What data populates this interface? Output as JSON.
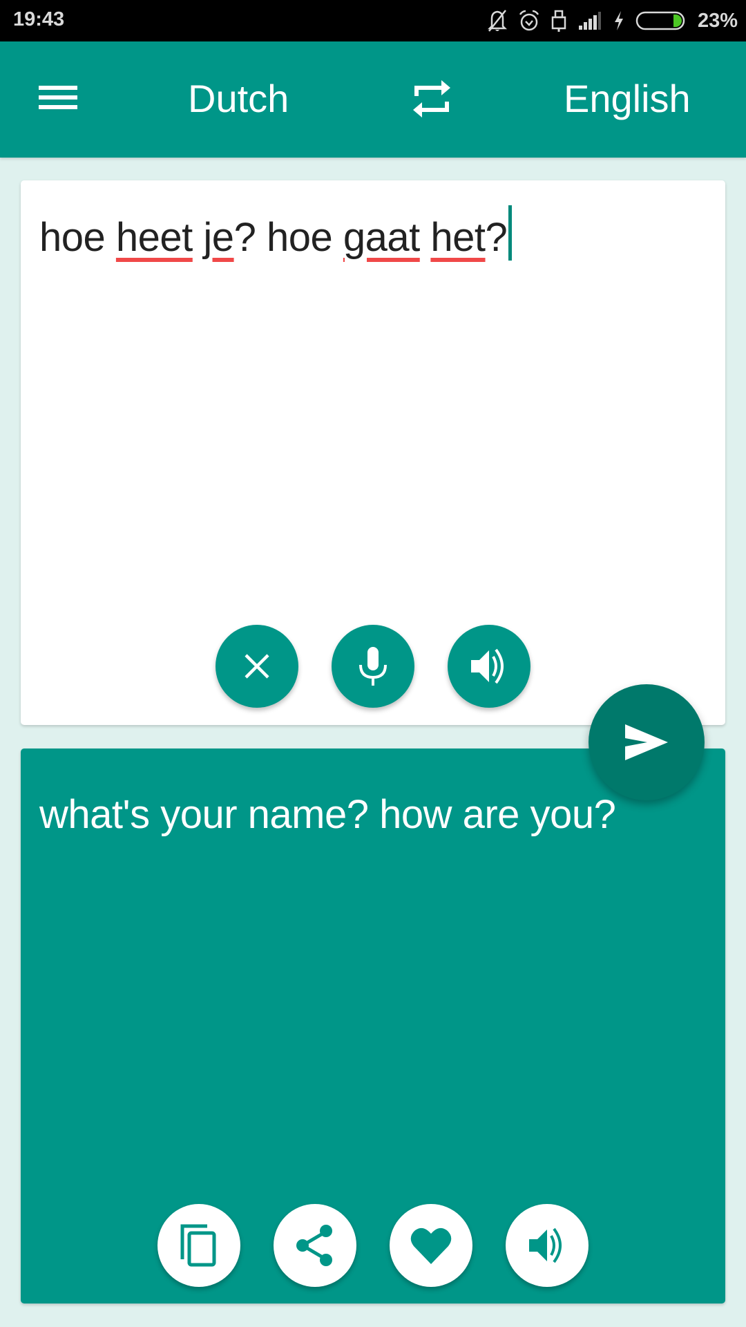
{
  "status_bar": {
    "time": "19:43",
    "battery_percent": "23%",
    "battery_level": 0.23,
    "icons": [
      "notifications-off-icon",
      "alarm-icon",
      "lock-icon",
      "signal-icon",
      "charging-icon",
      "battery-icon"
    ]
  },
  "app_bar": {
    "menu_icon": "hamburger-menu-icon",
    "source_language": "Dutch",
    "swap_icon": "swap-languages-icon",
    "target_language": "English"
  },
  "input_card": {
    "words": [
      {
        "text": "hoe",
        "misspelled": false
      },
      {
        "text": "heet",
        "misspelled": true
      },
      {
        "text": "je",
        "misspelled": true
      },
      {
        "text": "?",
        "misspelled": false
      },
      {
        "text": "hoe",
        "misspelled": false
      },
      {
        "text": "gaat",
        "misspelled": true
      },
      {
        "text": "het",
        "misspelled": true
      },
      {
        "text": "?",
        "misspelled": false
      }
    ],
    "value": "hoe heet je? hoe gaat het?",
    "buttons": [
      {
        "name": "clear",
        "icon": "close-icon"
      },
      {
        "name": "voice-input",
        "icon": "microphone-icon"
      },
      {
        "name": "speak-source",
        "icon": "speaker-icon"
      }
    ]
  },
  "translate_button": {
    "icon": "send-icon"
  },
  "output_card": {
    "value": "what's your name? how are you?",
    "buttons": [
      {
        "name": "copy",
        "icon": "copy-icon"
      },
      {
        "name": "share",
        "icon": "share-icon"
      },
      {
        "name": "favorite",
        "icon": "heart-icon"
      },
      {
        "name": "speak-translation",
        "icon": "speaker-icon"
      }
    ]
  },
  "colors": {
    "primary": "#009688",
    "primary_dark": "#00796b",
    "background": "#dff1ee",
    "spellcheck_underline": "#f04848",
    "battery_fill": "#4cc624"
  }
}
